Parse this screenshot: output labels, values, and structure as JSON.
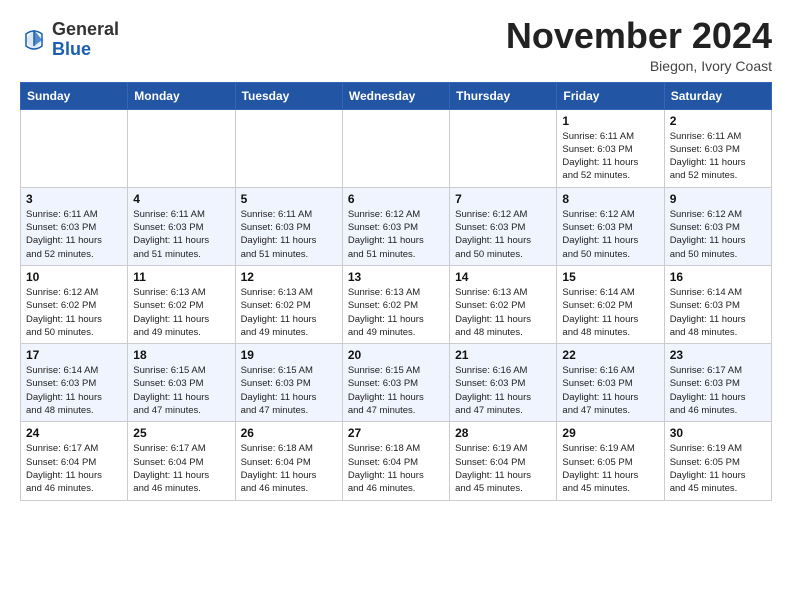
{
  "header": {
    "logo": {
      "line1": "General",
      "line2": "Blue"
    },
    "title": "November 2024",
    "subtitle": "Biegon, Ivory Coast"
  },
  "days_of_week": [
    "Sunday",
    "Monday",
    "Tuesday",
    "Wednesday",
    "Thursday",
    "Friday",
    "Saturday"
  ],
  "weeks": [
    [
      {
        "day": "",
        "info": ""
      },
      {
        "day": "",
        "info": ""
      },
      {
        "day": "",
        "info": ""
      },
      {
        "day": "",
        "info": ""
      },
      {
        "day": "",
        "info": ""
      },
      {
        "day": "1",
        "info": "Sunrise: 6:11 AM\nSunset: 6:03 PM\nDaylight: 11 hours\nand 52 minutes."
      },
      {
        "day": "2",
        "info": "Sunrise: 6:11 AM\nSunset: 6:03 PM\nDaylight: 11 hours\nand 52 minutes."
      }
    ],
    [
      {
        "day": "3",
        "info": "Sunrise: 6:11 AM\nSunset: 6:03 PM\nDaylight: 11 hours\nand 52 minutes."
      },
      {
        "day": "4",
        "info": "Sunrise: 6:11 AM\nSunset: 6:03 PM\nDaylight: 11 hours\nand 51 minutes."
      },
      {
        "day": "5",
        "info": "Sunrise: 6:11 AM\nSunset: 6:03 PM\nDaylight: 11 hours\nand 51 minutes."
      },
      {
        "day": "6",
        "info": "Sunrise: 6:12 AM\nSunset: 6:03 PM\nDaylight: 11 hours\nand 51 minutes."
      },
      {
        "day": "7",
        "info": "Sunrise: 6:12 AM\nSunset: 6:03 PM\nDaylight: 11 hours\nand 50 minutes."
      },
      {
        "day": "8",
        "info": "Sunrise: 6:12 AM\nSunset: 6:03 PM\nDaylight: 11 hours\nand 50 minutes."
      },
      {
        "day": "9",
        "info": "Sunrise: 6:12 AM\nSunset: 6:03 PM\nDaylight: 11 hours\nand 50 minutes."
      }
    ],
    [
      {
        "day": "10",
        "info": "Sunrise: 6:12 AM\nSunset: 6:02 PM\nDaylight: 11 hours\nand 50 minutes."
      },
      {
        "day": "11",
        "info": "Sunrise: 6:13 AM\nSunset: 6:02 PM\nDaylight: 11 hours\nand 49 minutes."
      },
      {
        "day": "12",
        "info": "Sunrise: 6:13 AM\nSunset: 6:02 PM\nDaylight: 11 hours\nand 49 minutes."
      },
      {
        "day": "13",
        "info": "Sunrise: 6:13 AM\nSunset: 6:02 PM\nDaylight: 11 hours\nand 49 minutes."
      },
      {
        "day": "14",
        "info": "Sunrise: 6:13 AM\nSunset: 6:02 PM\nDaylight: 11 hours\nand 48 minutes."
      },
      {
        "day": "15",
        "info": "Sunrise: 6:14 AM\nSunset: 6:02 PM\nDaylight: 11 hours\nand 48 minutes."
      },
      {
        "day": "16",
        "info": "Sunrise: 6:14 AM\nSunset: 6:03 PM\nDaylight: 11 hours\nand 48 minutes."
      }
    ],
    [
      {
        "day": "17",
        "info": "Sunrise: 6:14 AM\nSunset: 6:03 PM\nDaylight: 11 hours\nand 48 minutes."
      },
      {
        "day": "18",
        "info": "Sunrise: 6:15 AM\nSunset: 6:03 PM\nDaylight: 11 hours\nand 47 minutes."
      },
      {
        "day": "19",
        "info": "Sunrise: 6:15 AM\nSunset: 6:03 PM\nDaylight: 11 hours\nand 47 minutes."
      },
      {
        "day": "20",
        "info": "Sunrise: 6:15 AM\nSunset: 6:03 PM\nDaylight: 11 hours\nand 47 minutes."
      },
      {
        "day": "21",
        "info": "Sunrise: 6:16 AM\nSunset: 6:03 PM\nDaylight: 11 hours\nand 47 minutes."
      },
      {
        "day": "22",
        "info": "Sunrise: 6:16 AM\nSunset: 6:03 PM\nDaylight: 11 hours\nand 47 minutes."
      },
      {
        "day": "23",
        "info": "Sunrise: 6:17 AM\nSunset: 6:03 PM\nDaylight: 11 hours\nand 46 minutes."
      }
    ],
    [
      {
        "day": "24",
        "info": "Sunrise: 6:17 AM\nSunset: 6:04 PM\nDaylight: 11 hours\nand 46 minutes."
      },
      {
        "day": "25",
        "info": "Sunrise: 6:17 AM\nSunset: 6:04 PM\nDaylight: 11 hours\nand 46 minutes."
      },
      {
        "day": "26",
        "info": "Sunrise: 6:18 AM\nSunset: 6:04 PM\nDaylight: 11 hours\nand 46 minutes."
      },
      {
        "day": "27",
        "info": "Sunrise: 6:18 AM\nSunset: 6:04 PM\nDaylight: 11 hours\nand 46 minutes."
      },
      {
        "day": "28",
        "info": "Sunrise: 6:19 AM\nSunset: 6:04 PM\nDaylight: 11 hours\nand 45 minutes."
      },
      {
        "day": "29",
        "info": "Sunrise: 6:19 AM\nSunset: 6:05 PM\nDaylight: 11 hours\nand 45 minutes."
      },
      {
        "day": "30",
        "info": "Sunrise: 6:19 AM\nSunset: 6:05 PM\nDaylight: 11 hours\nand 45 minutes."
      }
    ]
  ]
}
